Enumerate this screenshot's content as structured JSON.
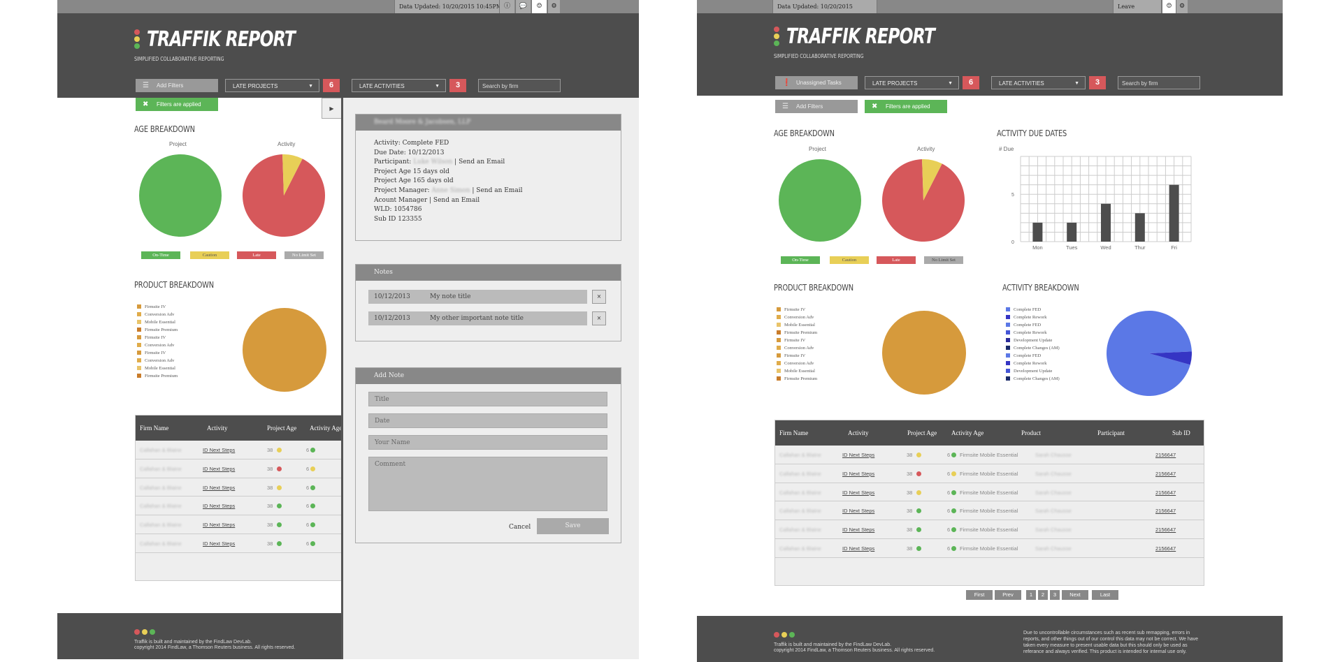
{
  "app": {
    "logo": "TRAFFIK REPORT",
    "tagline": "SIMPLIFIED COLLABORATIVE REPORTING"
  },
  "topbar": {
    "data_updated": "Data Updated: 10/20/2015 10:45PM",
    "feedback": "Leave Feedback",
    "info_icon": "info-icon",
    "chat_icon": "chat-icon",
    "gear_icon": "gear-icon"
  },
  "controls": {
    "unassigned_tasks": "Unassigned Tasks",
    "add_filters": "Add Filters",
    "filters_applied": "Filters are applied",
    "late_projects": "LATE PROJECTS",
    "late_projects_count": "6",
    "late_activities": "LATE ACTIVITIES",
    "late_activities_count": "3",
    "search_placeholder": "Search by firm"
  },
  "sections": {
    "age_breakdown": "AGE BREAKDOWN",
    "product_breakdown": "PRODUCT BREAKDOWN",
    "activity_due_dates": "ACTIVITY DUE DATES",
    "activity_breakdown": "ACTIVITY BREAKDOWN",
    "project_label": "Project",
    "activity_label": "Activity"
  },
  "age_legend": [
    {
      "label": "On-Time",
      "color": "#5cb557"
    },
    {
      "label": "Caution",
      "color": "#e8cf57"
    },
    {
      "label": "Late",
      "color": "#d6585b"
    },
    {
      "label": "No Limit Set",
      "color": "#aaaaaa"
    }
  ],
  "product_legend": [
    {
      "label": "Firmsite IV",
      "color": "#d69a3c"
    },
    {
      "label": "Conversion Adv",
      "color": "#e0ac4a"
    },
    {
      "label": "Mobile Essential",
      "color": "#e9c46a"
    },
    {
      "label": "Firmsite Premium",
      "color": "#c97c2a"
    },
    {
      "label": "Firmsite IV",
      "color": "#d69a3c"
    },
    {
      "label": "Conversion Adv",
      "color": "#e0ac4a"
    },
    {
      "label": "Firmsite IV",
      "color": "#d69a3c"
    },
    {
      "label": "Conversion Adv",
      "color": "#e0ac4a"
    },
    {
      "label": "Mobile Essential",
      "color": "#e9c46a"
    },
    {
      "label": "Firmsite Premium",
      "color": "#c97c2a"
    }
  ],
  "activity_legend": [
    {
      "label": "Complete FED",
      "color": "#5b78e6"
    },
    {
      "label": "Complete Rework",
      "color": "#3535c4"
    },
    {
      "label": "Complete FED",
      "color": "#5b78e6"
    },
    {
      "label": "Complete Rework",
      "color": "#4455d6"
    },
    {
      "label": "Development Update",
      "color": "#2a2a9a"
    },
    {
      "label": "Complete Changes (AM)",
      "color": "#1a2a6a"
    },
    {
      "label": "Complete FED",
      "color": "#5b78e6"
    },
    {
      "label": "Complete Rework",
      "color": "#3535c4"
    },
    {
      "label": "Development Update",
      "color": "#4455d6"
    },
    {
      "label": "Complete Changes (AM)",
      "color": "#1a2a6a"
    }
  ],
  "table": {
    "headers": [
      "Firm Name",
      "Activity",
      "Project Age",
      "Activity Age",
      "Product",
      "Participant",
      "Sub ID"
    ],
    "rows": [
      {
        "firm": "Callahan & Blaine",
        "activity": "ID Next Steps",
        "project_age": "38",
        "pa_color": "#e8cf57",
        "activity_age": "6",
        "aa_color": "#5cb557",
        "product": "Firmsite Mobile Essential",
        "participant": "Sarah Chausse",
        "sub_id": "2156647"
      },
      {
        "firm": "Callahan & Blaine",
        "activity": "ID Next Steps",
        "project_age": "38",
        "pa_color": "#d6585b",
        "activity_age": "6",
        "aa_color": "#e8cf57",
        "product": "Firmsite Mobile Essential",
        "participant": "Sarah Chausse",
        "sub_id": "2156647"
      },
      {
        "firm": "Callahan & Blaine",
        "activity": "ID Next Steps",
        "project_age": "38",
        "pa_color": "#e8cf57",
        "activity_age": "6",
        "aa_color": "#5cb557",
        "product": "Firmsite Mobile Essential",
        "participant": "Sarah Chausse",
        "sub_id": "2156647"
      },
      {
        "firm": "Callahan & Blaine",
        "activity": "ID Next Steps",
        "project_age": "38",
        "pa_color": "#5cb557",
        "activity_age": "6",
        "aa_color": "#5cb557",
        "product": "Firmsite Mobile Essential",
        "participant": "Sarah Chausse",
        "sub_id": "2156647"
      },
      {
        "firm": "Callahan & Blaine",
        "activity": "ID Next Steps",
        "project_age": "38",
        "pa_color": "#5cb557",
        "activity_age": "6",
        "aa_color": "#5cb557",
        "product": "Firmsite Mobile Essential",
        "participant": "Sarah Chausse",
        "sub_id": "2156647"
      },
      {
        "firm": "Callahan & Blaine",
        "activity": "ID Next Steps",
        "project_age": "38",
        "pa_color": "#5cb557",
        "activity_age": "6",
        "aa_color": "#5cb557",
        "product": "Firmsite Mobile Essential",
        "participant": "Sarah Chausse",
        "sub_id": "2156647"
      }
    ]
  },
  "pagination": [
    "First",
    "Prev",
    "1",
    "2",
    "3",
    "Next",
    "Last"
  ],
  "detail": {
    "firm_title": "Beard Moore & Jacobsen, LLP",
    "activity": "Activity: Complete FED",
    "due_date": "Due Date: 10/12/2013",
    "participant_label": "Participant:",
    "participant_name": "Luke Wilson",
    "send_email": "| Send an Email",
    "project_age_1": "Project Age 15 days old",
    "project_age_2": "Project Age 165 days old",
    "project_manager_label": "Project Manager:",
    "project_manager_name": "Anne Simon",
    "account_manager": "Acount Manager | Send an Email",
    "wld": "WLD: 1054786",
    "sub_id": "Sub ID 123355"
  },
  "notes": {
    "title": "Notes",
    "items": [
      {
        "date": "10/12/2013",
        "title": "My note title"
      },
      {
        "date": "10/12/2013",
        "title": "My other important note title"
      }
    ],
    "remove": "×"
  },
  "add_note": {
    "title": "Add Note",
    "title_placeholder": "Title",
    "date_placeholder": "Date",
    "name_placeholder": "Your Name",
    "comment_placeholder": "Comment",
    "cancel": "Cancel",
    "save": "Save"
  },
  "footer": {
    "line1": "Traffik is built and maintained by the FindLaw DevLab.",
    "line2": "copyright 2014 FindLaw, a Thomson Reuters business. All rights reserved.",
    "disclaimer": "Due to uncontrollable circumstances such as recent sub remapping, errors in reports, and other things out of our control this data may not be correct. We have taken every measure to present usable data but this should only be used as referance and always verified. This product is intended for internal use only."
  },
  "chart_data": [
    {
      "type": "pie",
      "title": "Project",
      "labels": [
        "On-Time"
      ],
      "values": [
        100
      ],
      "colors": [
        "#5cb557"
      ]
    },
    {
      "type": "pie",
      "title": "Activity",
      "labels": [
        "Late",
        "Caution"
      ],
      "values": [
        92,
        8
      ],
      "colors": [
        "#d6585b",
        "#e8cf57"
      ]
    },
    {
      "type": "pie",
      "title": "",
      "labels": [
        "Firmsite"
      ],
      "values": [
        100
      ],
      "colors": [
        "#d69a3c"
      ]
    },
    {
      "type": "pie",
      "title": "",
      "labels": [
        "Complete FED",
        "Complete Rework"
      ],
      "values": [
        95,
        5
      ],
      "colors": [
        "#5b78e6",
        "#3535c4"
      ]
    },
    {
      "type": "bar",
      "title": "",
      "ylabel": "# Due",
      "categories": [
        "Mon",
        "Tues",
        "Wed",
        "Thur",
        "Fri"
      ],
      "values": [
        2,
        2,
        4,
        3,
        6
      ],
      "ylim": [
        0,
        9
      ],
      "yticks": [
        0,
        5
      ],
      "grid": true
    }
  ]
}
